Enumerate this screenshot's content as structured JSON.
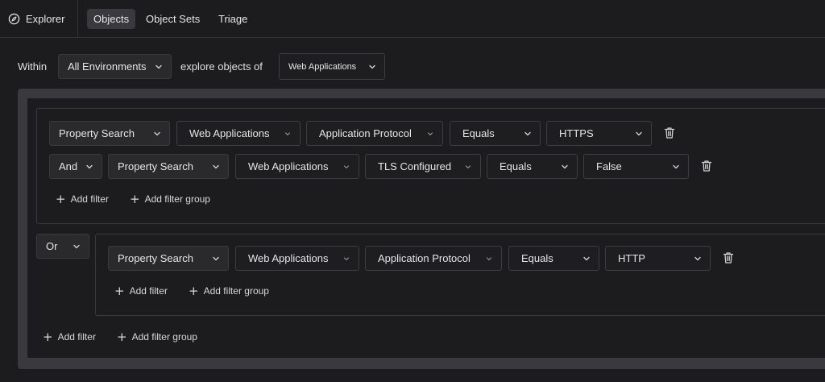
{
  "topbar": {
    "brand": "Explorer",
    "tabs": [
      "Objects",
      "Object Sets",
      "Triage"
    ]
  },
  "scope": {
    "within_label": "Within",
    "environment": "All Environments",
    "explore_label": "explore objects of",
    "object_type": "Web Applications"
  },
  "group1": {
    "row1": {
      "search": "Property Search",
      "type": "Web Applications",
      "property": "Application Protocol",
      "op": "Equals",
      "value": "HTTPS"
    },
    "row2": {
      "conj": "And",
      "search": "Property Search",
      "type": "Web Applications",
      "property": "TLS Configured",
      "op": "Equals",
      "value": "False"
    },
    "add_filter": "Add filter",
    "add_group": "Add filter group"
  },
  "group2": {
    "conj": "Or",
    "row1": {
      "search": "Property Search",
      "type": "Web Applications",
      "property": "Application Protocol",
      "op": "Equals",
      "value": "HTTP"
    },
    "add_filter": "Add filter",
    "add_group": "Add filter group"
  },
  "root": {
    "add_filter": "Add filter",
    "add_group": "Add filter group"
  },
  "icons": {
    "brand": "compass-icon",
    "dropdown": "chevron-down-icon",
    "delete": "trash-icon",
    "add": "plus-icon"
  },
  "colors": {
    "background": "#1c1c1e",
    "frame": "#3a3a3e",
    "active_tab": "#3a3a3e",
    "text": "#e6e6e6"
  }
}
